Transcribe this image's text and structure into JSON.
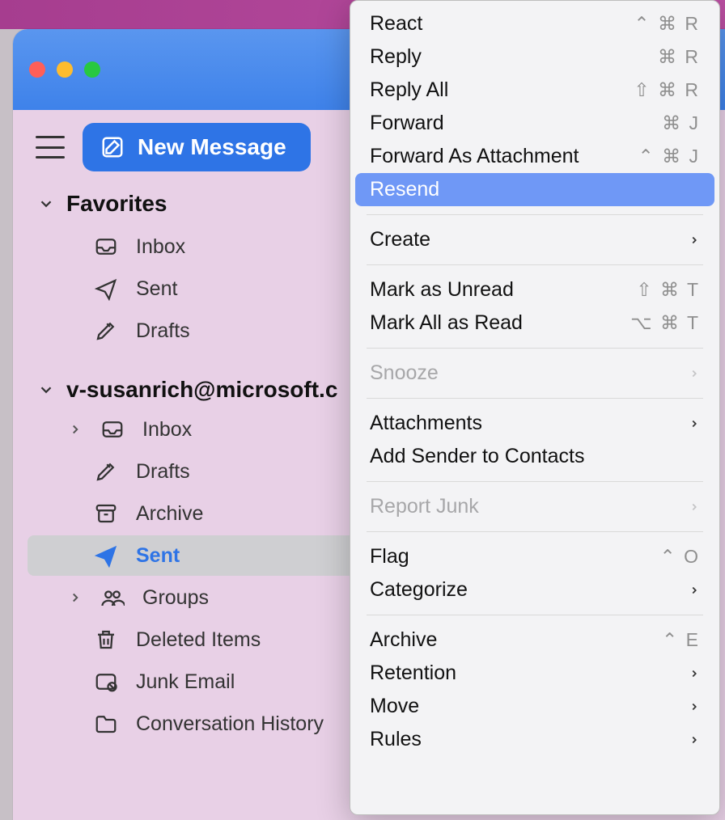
{
  "toolbar": {
    "new_message": "New Message"
  },
  "sidebar": {
    "favorites_label": "Favorites",
    "favorites": [
      {
        "label": "Inbox",
        "icon": "inbox"
      },
      {
        "label": "Sent",
        "icon": "sent"
      },
      {
        "label": "Drafts",
        "icon": "drafts"
      }
    ],
    "account_label": "v-susanrich@microsoft.c",
    "folders": [
      {
        "label": "Inbox",
        "icon": "inbox",
        "expandable": true
      },
      {
        "label": "Drafts",
        "icon": "drafts"
      },
      {
        "label": "Archive",
        "icon": "archive"
      },
      {
        "label": "Sent",
        "icon": "sent",
        "selected": true
      },
      {
        "label": "Groups",
        "icon": "groups",
        "expandable": true
      },
      {
        "label": "Deleted Items",
        "icon": "trash"
      },
      {
        "label": "Junk Email",
        "icon": "junk"
      },
      {
        "label": "Conversation History",
        "icon": "folder"
      }
    ]
  },
  "menu": {
    "groups": [
      [
        {
          "label": "React",
          "shortcut": "⌃ ⌘ R"
        },
        {
          "label": "Reply",
          "shortcut": "⌘ R"
        },
        {
          "label": "Reply All",
          "shortcut": "⇧ ⌘ R"
        },
        {
          "label": "Forward",
          "shortcut": "⌘  J"
        },
        {
          "label": "Forward As Attachment",
          "shortcut": "⌃ ⌘  J"
        },
        {
          "label": "Resend",
          "highlight": true
        }
      ],
      [
        {
          "label": "Create",
          "submenu": true
        }
      ],
      [
        {
          "label": "Mark as Unread",
          "shortcut": "⇧ ⌘ T"
        },
        {
          "label": "Mark All as Read",
          "shortcut": "⌥ ⌘ T"
        }
      ],
      [
        {
          "label": "Snooze",
          "submenu": true,
          "disabled": true
        }
      ],
      [
        {
          "label": "Attachments",
          "submenu": true
        },
        {
          "label": "Add Sender to Contacts"
        }
      ],
      [
        {
          "label": "Report Junk",
          "submenu": true,
          "disabled": true
        }
      ],
      [
        {
          "label": "Flag",
          "shortcut": "⌃ O"
        },
        {
          "label": "Categorize",
          "submenu": true
        }
      ],
      [
        {
          "label": "Archive",
          "shortcut": "⌃ E"
        },
        {
          "label": "Retention",
          "submenu": true
        },
        {
          "label": "Move",
          "submenu": true
        },
        {
          "label": "Rules",
          "submenu": true
        }
      ]
    ]
  }
}
